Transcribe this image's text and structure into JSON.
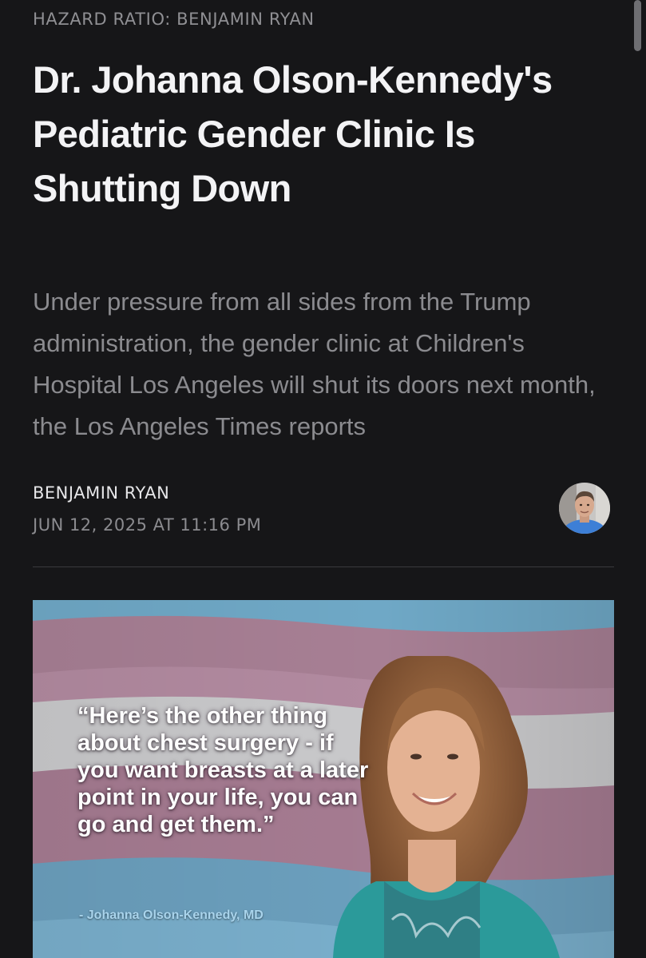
{
  "article": {
    "publication": "HAZARD RATIO: BENJAMIN RYAN",
    "title": "Dr. Johanna Olson-Kennedy's Pediatric Gender Clinic Is Shutting Down",
    "subtitle": "Under pressure from all sides from the Trump administration, the gender clinic at Children's Hospital Los Angeles will shut its doors next month, the Los Angeles Times reports",
    "author": "BENJAMIN RYAN",
    "date": "JUN 12, 2025 AT 11:16 PM"
  },
  "hero_image": {
    "quote": "“Here’s the other thing about chest surgery - if you want breasts at a later point in your life, you can go and get them.”",
    "attribution": "- Johanna Olson-Kennedy, MD",
    "icon": "flag-background"
  },
  "colors": {
    "background": "#161618",
    "title": "#f3f3f5",
    "muted_text": "#8b8b8f",
    "flag_blue": "#6fa8c6",
    "flag_pink": "#a77f94",
    "flag_white": "#c9c9cb",
    "attribution": "#a9d4ec"
  }
}
